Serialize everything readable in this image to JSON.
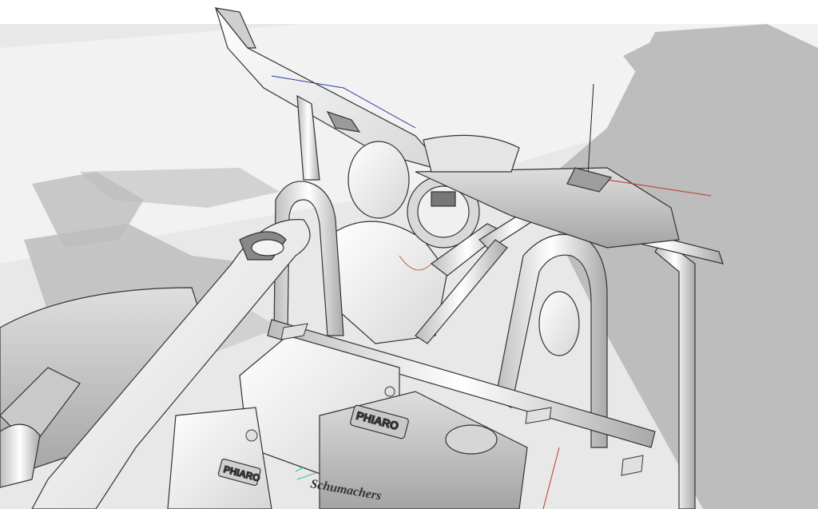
{
  "viewport": {
    "render_style": "hidden-line-shaded",
    "background_color": "#ffffff",
    "ground_color": "#e9e9e9",
    "shadow_color": "#b9b9b9",
    "line_color": "#3a3a3a",
    "axis_colors": {
      "red_axis": "#c0392b",
      "green_axis": "#2ecc71",
      "blue_axis": "#2c3e9e"
    }
  },
  "model": {
    "engine_cover_logo": "PHIARO",
    "side_intake_logo": "PHIARO",
    "decal_text": "Schumachers"
  }
}
